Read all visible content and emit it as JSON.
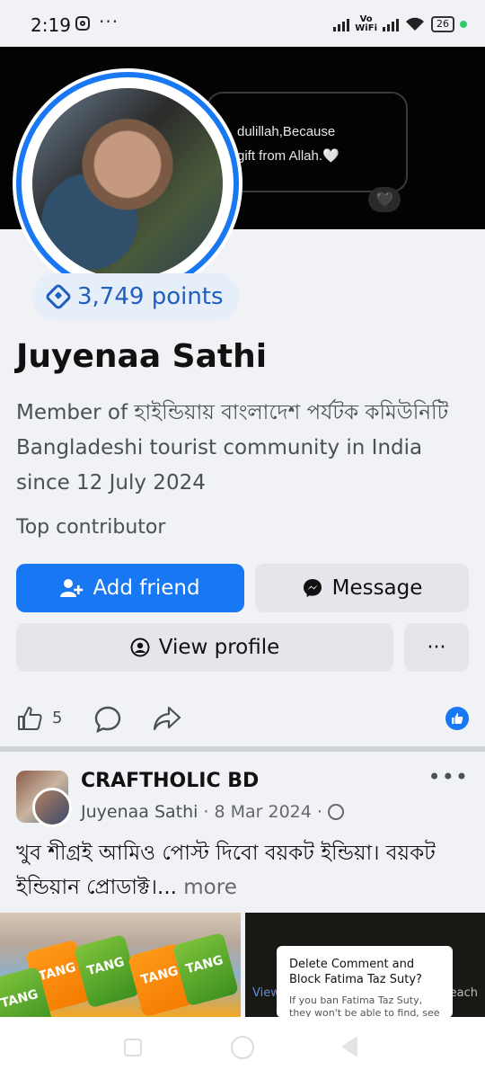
{
  "status_bar": {
    "time": "2:19",
    "more": "···",
    "vo": "Vo",
    "wifi_label": "WiFi",
    "battery": "26"
  },
  "cover": {
    "line1": "dulillah,Because",
    "line2": "gift from Allah.🤍",
    "heart": "🖤"
  },
  "profile": {
    "points": "3,749 points",
    "name": "Juyenaa Sathi",
    "description": "Member of হাইন্ডিয়ায় বাংলাদেশ পর্যটক কমিউনিটি Bangladeshi tourist community in India since 12 July 2024",
    "badge": "Top contributor"
  },
  "actions": {
    "add_friend": "Add friend",
    "message": "Message",
    "view_profile": "View profile",
    "more": "···"
  },
  "reactions": {
    "like_count": "5"
  },
  "post": {
    "group": "CRAFTHOLIC BD",
    "author": "Juyenaa Sathi",
    "sep": "·",
    "date": "8 Mar 2024",
    "dots": "•••",
    "text": "খুব শীগ্রই আমিও পোস্ট দিবো বয়কট ইন্ডিয়া। বয়কট ইন্ডিয়ান প্রোডাক্ট।...",
    "more": "more"
  },
  "images": {
    "tang": "TANG",
    "dialog_title": "Delete Comment and Block Fatima Taz Suty?",
    "dialog_sub": "If you ban Fatima Taz Suty, they won't be able to find, see",
    "view": "View",
    "each": "each"
  },
  "colors": {
    "accent": "#1877f2",
    "button_grey": "#e4e6eb",
    "background": "#f0f2f5"
  }
}
